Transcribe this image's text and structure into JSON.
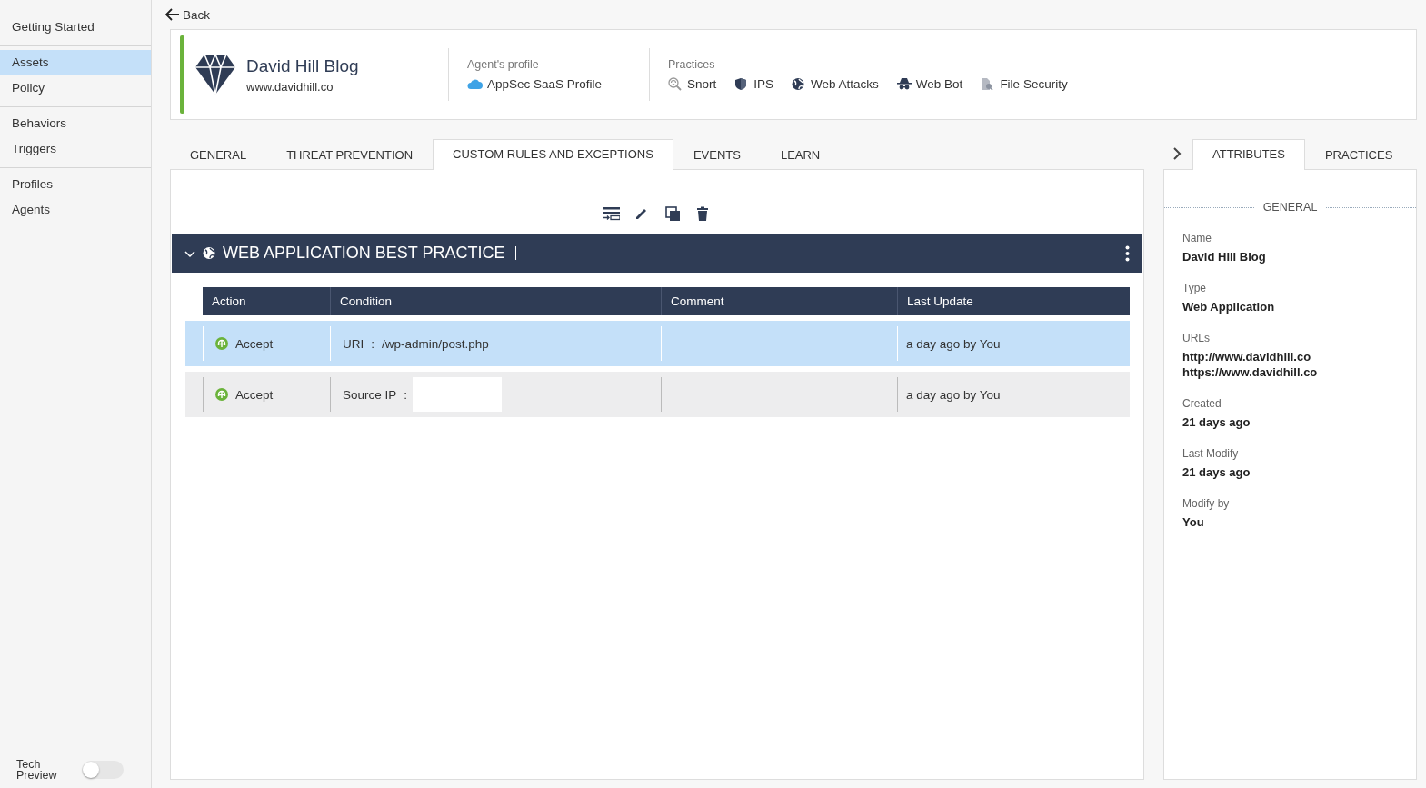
{
  "sidebar": {
    "groups": [
      {
        "items": [
          {
            "label": "Getting Started",
            "selected": false
          }
        ]
      },
      {
        "items": [
          {
            "label": "Assets",
            "selected": true
          },
          {
            "label": "Policy",
            "selected": false
          }
        ]
      },
      {
        "items": [
          {
            "label": "Behaviors",
            "selected": false
          },
          {
            "label": "Triggers",
            "selected": false
          }
        ]
      },
      {
        "items": [
          {
            "label": "Profiles",
            "selected": false
          },
          {
            "label": "Agents",
            "selected": false
          }
        ]
      }
    ],
    "tech_preview": {
      "label": "Tech Preview",
      "on": false
    }
  },
  "back": "Back",
  "asset": {
    "name": "David Hill Blog",
    "url": "www.davidhill.co",
    "agent_profile_label": "Agent's profile",
    "agent_profile": "AppSec SaaS Profile",
    "practices_label": "Practices",
    "practices": [
      {
        "kind": "snort",
        "label": "Snort"
      },
      {
        "kind": "ips",
        "label": "IPS"
      },
      {
        "kind": "web_attacks",
        "label": "Web Attacks"
      },
      {
        "kind": "web_bot",
        "label": "Web Bot"
      },
      {
        "kind": "file_security",
        "label": "File Security"
      }
    ]
  },
  "tabs": [
    {
      "label": "GENERAL",
      "selected": false
    },
    {
      "label": "THREAT PREVENTION",
      "selected": false
    },
    {
      "label": "CUSTOM RULES AND EXCEPTIONS",
      "selected": true
    },
    {
      "label": "EVENTS",
      "selected": false
    },
    {
      "label": "LEARN",
      "selected": false
    }
  ],
  "rule_group": {
    "title": "WEB APPLICATION BEST PRACTICE",
    "expanded": true
  },
  "table": {
    "columns": [
      "Action",
      "Condition",
      "Comment",
      "Last Update"
    ],
    "rows": [
      {
        "action": "Accept",
        "condition_field": "URI",
        "separator": ":",
        "condition_value": "/wp-admin/post.php",
        "last_update": "a day ago by You",
        "selected": true
      },
      {
        "action": "Accept",
        "condition_field": "Source IP",
        "separator": ":",
        "last_update": "a day ago by You",
        "selected": false
      }
    ]
  },
  "side_tabs": [
    {
      "label": "ATTRIBUTES",
      "selected": true
    },
    {
      "label": "PRACTICES",
      "selected": false
    }
  ],
  "attributes": {
    "section": "GENERAL",
    "fields": [
      {
        "label": "Name",
        "values": [
          "David Hill Blog"
        ]
      },
      {
        "label": "Type",
        "values": [
          "Web Application"
        ]
      },
      {
        "label": "URLs",
        "values": [
          "http://www.davidhill.co",
          "https://www.davidhill.co"
        ]
      },
      {
        "label": "Created",
        "values": [
          "21 days ago"
        ]
      },
      {
        "label": "Last Modify",
        "values": [
          "21 days ago"
        ]
      },
      {
        "label": "Modify by",
        "values": [
          "You"
        ]
      }
    ]
  }
}
